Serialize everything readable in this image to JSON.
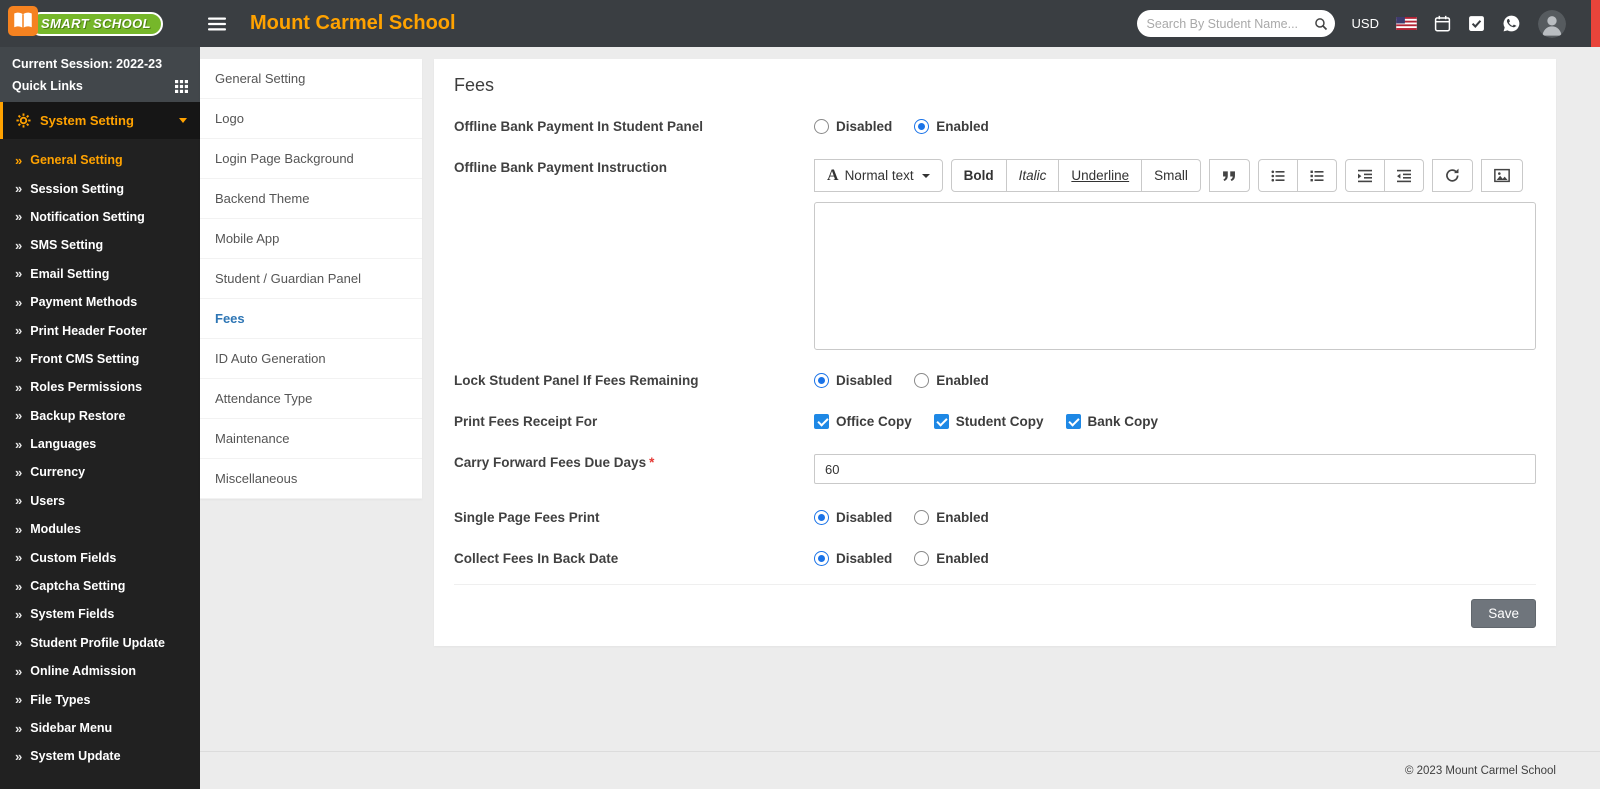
{
  "header": {
    "logo_text": "SMART SCHOOL",
    "school_name": "Mount Carmel School",
    "search": {
      "placeholder": "Search By Student Name..."
    },
    "currency_label": "USD",
    "icons": [
      "hamburger-icon",
      "search-icon",
      "us-flag-icon",
      "calendar-icon",
      "task-check-icon",
      "whatsapp-icon",
      "user-avatar",
      "quick-settings-strip"
    ]
  },
  "sidebar": {
    "session_label": "Current Session: 2022-23",
    "quick_links_label": "Quick Links",
    "section": {
      "label": "System Setting",
      "icon": "gear-icon",
      "expanded": true
    },
    "items": [
      {
        "label": "General Setting",
        "active": true
      },
      {
        "label": "Session Setting",
        "active": false
      },
      {
        "label": "Notification Setting",
        "active": false
      },
      {
        "label": "SMS Setting",
        "active": false
      },
      {
        "label": "Email Setting",
        "active": false
      },
      {
        "label": "Payment Methods",
        "active": false
      },
      {
        "label": "Print Header Footer",
        "active": false
      },
      {
        "label": "Front CMS Setting",
        "active": false
      },
      {
        "label": "Roles Permissions",
        "active": false
      },
      {
        "label": "Backup Restore",
        "active": false
      },
      {
        "label": "Languages",
        "active": false
      },
      {
        "label": "Currency",
        "active": false
      },
      {
        "label": "Users",
        "active": false
      },
      {
        "label": "Modules",
        "active": false
      },
      {
        "label": "Custom Fields",
        "active": false
      },
      {
        "label": "Captcha Setting",
        "active": false
      },
      {
        "label": "System Fields",
        "active": false
      },
      {
        "label": "Student Profile Update",
        "active": false
      },
      {
        "label": "Online Admission",
        "active": false
      },
      {
        "label": "File Types",
        "active": false
      },
      {
        "label": "Sidebar Menu",
        "active": false
      },
      {
        "label": "System Update",
        "active": false
      }
    ]
  },
  "settings_menu": {
    "items": [
      {
        "label": "General Setting",
        "active": false
      },
      {
        "label": "Logo",
        "active": false
      },
      {
        "label": "Login Page Background",
        "active": false
      },
      {
        "label": "Backend Theme",
        "active": false
      },
      {
        "label": "Mobile App",
        "active": false
      },
      {
        "label": "Student / Guardian Panel",
        "active": false
      },
      {
        "label": "Fees",
        "active": true
      },
      {
        "label": "ID Auto Generation",
        "active": false
      },
      {
        "label": "Attendance Type",
        "active": false
      },
      {
        "label": "Maintenance",
        "active": false
      },
      {
        "label": "Miscellaneous",
        "active": false
      }
    ]
  },
  "main": {
    "title": "Fees",
    "fields": {
      "offline_bank_payment": {
        "label": "Offline Bank Payment In Student Panel",
        "options": [
          "Disabled",
          "Enabled"
        ],
        "value": "Enabled"
      },
      "offline_instruction": {
        "label": "Offline Bank Payment Instruction",
        "editor": {
          "style_dropdown": "Normal text",
          "buttons": [
            "Bold",
            "Italic",
            "Underline",
            "Small"
          ],
          "icon_buttons": [
            "blockquote-icon",
            "unordered-list-icon",
            "ordered-list-icon",
            "outdent-icon",
            "indent-icon",
            "redo-icon",
            "insert-picture-icon"
          ],
          "content": ""
        }
      },
      "lock_student_panel": {
        "label": "Lock Student Panel If Fees Remaining",
        "options": [
          "Disabled",
          "Enabled"
        ],
        "value": "Disabled"
      },
      "print_fees_receipt": {
        "label": "Print Fees Receipt For",
        "options": [
          {
            "label": "Office Copy",
            "checked": true
          },
          {
            "label": "Student Copy",
            "checked": true
          },
          {
            "label": "Bank Copy",
            "checked": true
          }
        ]
      },
      "carry_forward_days": {
        "label": "Carry Forward Fees Due Days",
        "required_mark": "*",
        "value": "60"
      },
      "single_page_print": {
        "label": "Single Page Fees Print",
        "options": [
          "Disabled",
          "Enabled"
        ],
        "value": "Disabled"
      },
      "collect_back_date": {
        "label": "Collect Fees In Back Date",
        "options": [
          "Disabled",
          "Enabled"
        ],
        "value": "Disabled"
      }
    },
    "save_label": "Save"
  },
  "footer": {
    "copyright": "© 2023 Mount Carmel School"
  },
  "colors": {
    "header_bg": "#3a3e42",
    "sidebar_bg": "#212121",
    "accent_orange": "#ffa200",
    "logo_orange": "#f58220",
    "logo_green": "#76b72a",
    "active_blue": "#2e76b5",
    "control_blue": "#1a73e8",
    "red_strip": "#e8443a"
  }
}
